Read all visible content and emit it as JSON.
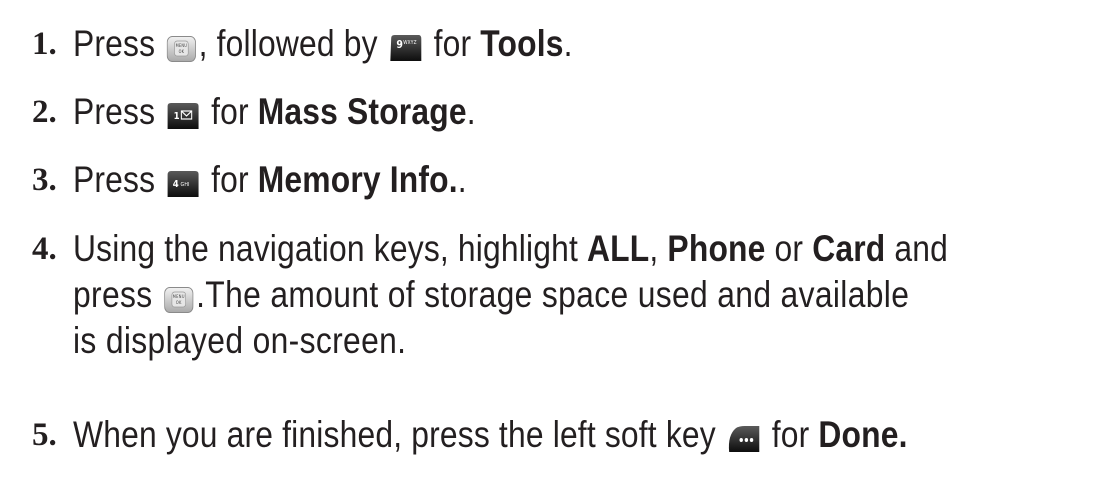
{
  "steps": [
    {
      "number": "1.",
      "parts": {
        "a": "Press ",
        "key1": "menu-ok-key-icon",
        "b": ", followed by ",
        "key2": "key-9-wxyz-icon",
        "c": " for ",
        "bold": "Tools",
        "d": "."
      }
    },
    {
      "number": "2.",
      "parts": {
        "a": "Press ",
        "key1": "key-1-mail-icon",
        "c": " for ",
        "bold": "Mass Storage",
        "d": "."
      }
    },
    {
      "number": "3.",
      "parts": {
        "a": "Press ",
        "key1": "key-4-ghi-icon",
        "c": " for ",
        "bold": "Memory Info.",
        "d": "."
      }
    },
    {
      "number": "4.",
      "parts": {
        "a": "Using the navigation keys, highlight ",
        "bold1": "ALL",
        "b": ", ",
        "bold2": "Phone",
        "c": " or ",
        "bold3": "Card",
        "d": " and",
        "e": "press ",
        "key1": "menu-ok-key-icon",
        "f": ".The amount of storage space used and available",
        "g": "is displayed on-screen."
      }
    },
    {
      "number": "5.",
      "parts": {
        "a": "When you are finished, press the left soft key ",
        "key1": "left-soft-key-icon",
        "c": " for ",
        "bold": "Done."
      }
    }
  ],
  "key_labels": {
    "menu_top": "MENU",
    "menu_bottom": "OK",
    "nine": "9",
    "nine_sub": "WXYZ",
    "one": "1",
    "four": "4",
    "four_sub": "GHI",
    "soft": "•••"
  },
  "colors": {
    "text": "#231f20",
    "key_dark": "#1a1a1a",
    "key_light": "#d9d9d9"
  }
}
